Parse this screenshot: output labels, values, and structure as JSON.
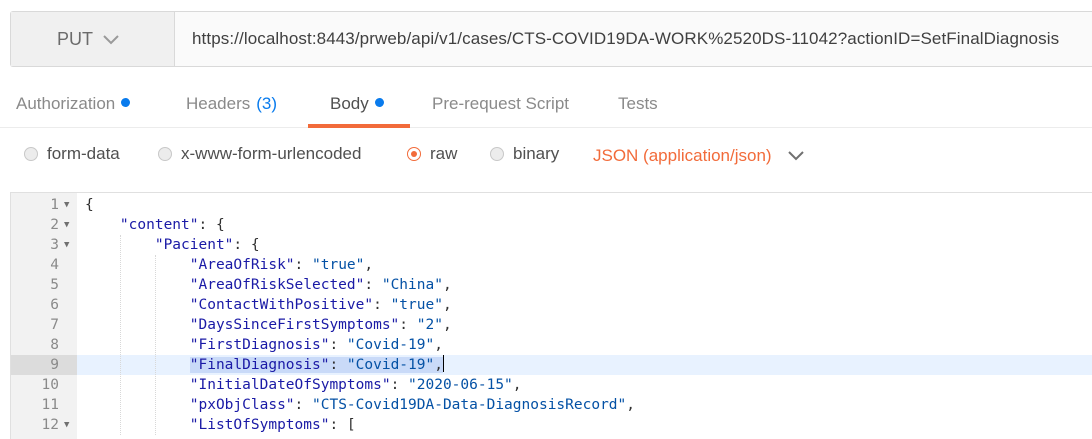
{
  "request": {
    "method": "PUT",
    "url": "https://localhost:8443/prweb/api/v1/cases/CTS-COVID19DA-WORK%2520DS-11042?actionID=SetFinalDiagnosis"
  },
  "tabs": [
    {
      "label": "Authorization",
      "count": "",
      "dot": true
    },
    {
      "label": "Headers",
      "count": "(3)",
      "dot": false
    },
    {
      "label": "Body",
      "count": "",
      "dot": true
    },
    {
      "label": "Pre-request Script",
      "count": "",
      "dot": false
    },
    {
      "label": "Tests",
      "count": "",
      "dot": false
    }
  ],
  "active_tab": "Body",
  "body_types": [
    {
      "label": "form-data",
      "checked": false
    },
    {
      "label": "x-www-form-urlencoded",
      "checked": false
    },
    {
      "label": "raw",
      "checked": true
    },
    {
      "label": "binary",
      "checked": false
    }
  ],
  "content_type": "JSON (application/json)",
  "editor": {
    "lines": [
      {
        "n": "1",
        "fold": true,
        "indent": 0,
        "parts": [
          [
            "p",
            "{"
          ]
        ]
      },
      {
        "n": "2",
        "fold": true,
        "indent": 1,
        "parts": [
          [
            "k",
            "\"content\""
          ],
          [
            "p",
            ": {"
          ]
        ]
      },
      {
        "n": "3",
        "fold": true,
        "indent": 2,
        "parts": [
          [
            "k",
            "\"Pacient\""
          ],
          [
            "p",
            ": {"
          ]
        ]
      },
      {
        "n": "4",
        "fold": false,
        "indent": 3,
        "parts": [
          [
            "k",
            "\"AreaOfRisk\""
          ],
          [
            "p",
            ": "
          ],
          [
            "s",
            "\"true\""
          ],
          [
            "p",
            ","
          ]
        ]
      },
      {
        "n": "5",
        "fold": false,
        "indent": 3,
        "parts": [
          [
            "k",
            "\"AreaOfRiskSelected\""
          ],
          [
            "p",
            ": "
          ],
          [
            "s",
            "\"China\""
          ],
          [
            "p",
            ","
          ]
        ]
      },
      {
        "n": "6",
        "fold": false,
        "indent": 3,
        "parts": [
          [
            "k",
            "\"ContactWithPositive\""
          ],
          [
            "p",
            ": "
          ],
          [
            "s",
            "\"true\""
          ],
          [
            "p",
            ","
          ]
        ]
      },
      {
        "n": "7",
        "fold": false,
        "indent": 3,
        "parts": [
          [
            "k",
            "\"DaysSinceFirstSymptoms\""
          ],
          [
            "p",
            ": "
          ],
          [
            "s",
            "\"2\""
          ],
          [
            "p",
            ","
          ]
        ]
      },
      {
        "n": "8",
        "fold": false,
        "indent": 3,
        "parts": [
          [
            "k",
            "\"FirstDiagnosis\""
          ],
          [
            "p",
            ": "
          ],
          [
            "s",
            "\"Covid-19\""
          ],
          [
            "p",
            ","
          ]
        ]
      },
      {
        "n": "9",
        "fold": false,
        "indent": 3,
        "active": true,
        "parts": [
          [
            "k",
            "\"FinalDiagnosis\""
          ],
          [
            "p",
            ": "
          ],
          [
            "s",
            "\"Covid-19\""
          ],
          [
            "p",
            ","
          ]
        ]
      },
      {
        "n": "10",
        "fold": false,
        "indent": 3,
        "parts": [
          [
            "k",
            "\"InitialDateOfSymptoms\""
          ],
          [
            "p",
            ": "
          ],
          [
            "s",
            "\"2020-06-15\""
          ],
          [
            "p",
            ","
          ]
        ]
      },
      {
        "n": "11",
        "fold": false,
        "indent": 3,
        "parts": [
          [
            "k",
            "\"pxObjClass\""
          ],
          [
            "p",
            ": "
          ],
          [
            "s",
            "\"CTS-Covid19DA-Data-DiagnosisRecord\""
          ],
          [
            "p",
            ","
          ]
        ]
      },
      {
        "n": "12",
        "fold": true,
        "indent": 3,
        "parts": [
          [
            "k",
            "\"ListOfSymptoms\""
          ],
          [
            "p",
            ": ["
          ]
        ]
      }
    ]
  },
  "icons": {
    "method_dropdown": "chevron-down-icon",
    "content_type_dropdown": "chevron-down-icon",
    "fold_marker": "fold-arrow-icon"
  },
  "colors": {
    "accent": "#f26b3a",
    "tab_dot": "#097bed",
    "json_key": "#1a1aa6",
    "json_string": "#0451a5"
  }
}
